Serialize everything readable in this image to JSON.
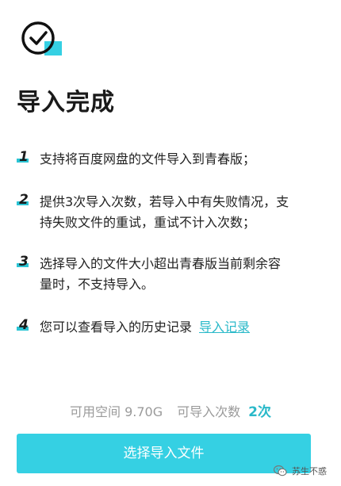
{
  "header": {
    "title": "导入完成"
  },
  "items": [
    {
      "number": "1",
      "lines": [
        "支持将百度网盘的文件导入到青春版；"
      ]
    },
    {
      "number": "2",
      "lines": [
        "提供3次导入次数，若导入中有失败情况，支",
        "持失败文件的重试，重试不计入次数；"
      ]
    },
    {
      "number": "3",
      "lines": [
        "选择导入的文件大小超出青春版当前剩余容",
        "量时，不支持导入。"
      ]
    },
    {
      "number": "4",
      "text": "您可以查看导入的历史记录",
      "link_label": "导入记录"
    }
  ],
  "info": {
    "space_label": "可用空间",
    "space_value": "9.70G",
    "count_label": "可导入次数",
    "count_value": "2次"
  },
  "actions": {
    "select_label": "选择导入文件"
  },
  "watermark": {
    "text": "苏生不惑"
  },
  "colors": {
    "accent": "#2ab9c9",
    "button": "#35d0e3",
    "number_bar": "#2ac4d4"
  },
  "icons": {
    "header": "check-circle-icon",
    "watermark": "wechat-icon"
  }
}
